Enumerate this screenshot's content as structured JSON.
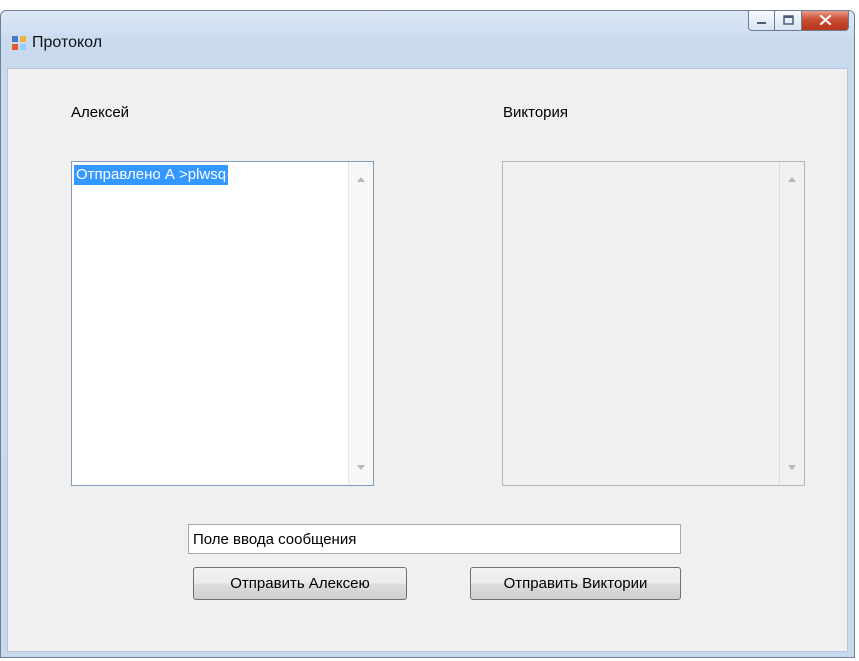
{
  "window": {
    "title": "Протокол",
    "icons": {
      "app": "window-app-icon",
      "minimize": "minimize-icon",
      "maximize": "maximize-icon",
      "close": "close-icon"
    }
  },
  "chat": {
    "left_label": "Алексей",
    "right_label": "Виктория",
    "left_messages": [
      "Отправлено А >plwsq"
    ],
    "right_messages": []
  },
  "composer": {
    "message_value": "Поле ввода сообщения"
  },
  "actions": {
    "send_to_alexey": "Отправить Алексею",
    "send_to_viktoria": "Отправить Виктории"
  }
}
